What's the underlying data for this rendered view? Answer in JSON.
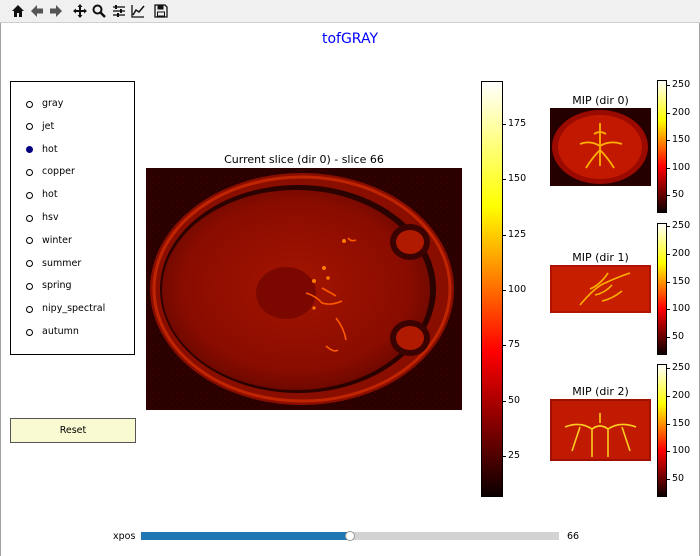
{
  "toolbar": {
    "buttons": [
      {
        "name": "home-icon"
      },
      {
        "name": "back-arrow-icon"
      },
      {
        "name": "forward-arrow-icon"
      },
      {
        "name": "pan-icon"
      },
      {
        "name": "zoom-icon"
      },
      {
        "name": "configure-subplots-icon"
      },
      {
        "name": "edit-axis-icon"
      },
      {
        "name": "save-icon"
      }
    ]
  },
  "figure": {
    "title": "tofGRAY"
  },
  "colormap_selector": {
    "options": [
      "gray",
      "jet",
      "hot",
      "copper",
      "hot",
      "hsv",
      "winter",
      "summer",
      "spring",
      "nipy_spectral",
      "autumn"
    ],
    "selected_index": 2
  },
  "reset_label": "Reset",
  "main_view": {
    "title": "Current slice (dir 0) - slice 66",
    "colorbar_ticks": [
      "175",
      "150",
      "125",
      "100",
      "75",
      "50",
      "25"
    ]
  },
  "mips": [
    {
      "title": "MIP (dir 0)",
      "ticks": [
        "250",
        "200",
        "150",
        "100",
        "50"
      ]
    },
    {
      "title": "MIP (dir 1)",
      "ticks": [
        "250",
        "200",
        "150",
        "100",
        "50"
      ]
    },
    {
      "title": "MIP (dir 2)",
      "ticks": [
        "250",
        "200",
        "150",
        "100",
        "50"
      ]
    }
  ],
  "slider": {
    "label": "xpos",
    "value": "66",
    "fraction": 0.5
  },
  "colors": {
    "title": "#0000ff",
    "selected_radio": "#000080",
    "slider_fill": "#1f77b4",
    "reset_bg": "#fafad2"
  }
}
